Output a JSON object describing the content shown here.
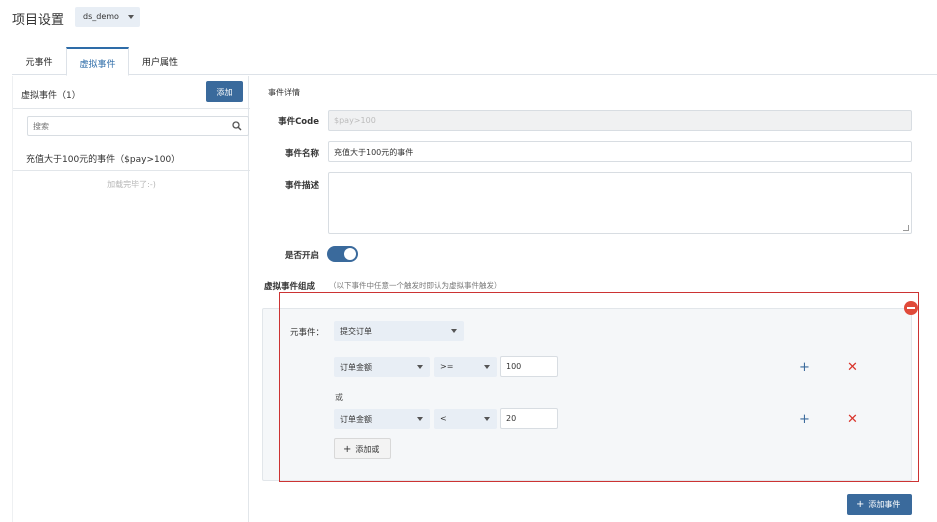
{
  "header": {
    "title": "项目设置",
    "project_select": "ds_demo"
  },
  "tabs": [
    {
      "label": "元事件"
    },
    {
      "label": "虚拟事件"
    },
    {
      "label": "用户属性"
    }
  ],
  "left": {
    "title": "虚拟事件（1）",
    "add_button": "添加",
    "search_placeholder": "搜索",
    "items": [
      {
        "label": "充值大于100元的事件（$pay>100）"
      }
    ],
    "loaded_text": "加载完毕了:-)"
  },
  "right": {
    "section_title": "事件详情",
    "event_code_label": "事件Code",
    "event_code_value": "$pay>100",
    "event_name_label": "事件名称",
    "event_name_value": "充值大于100元的事件",
    "event_desc_label": "事件描述",
    "enabled_label": "是否开启",
    "enabled": true,
    "composition_label": "虚拟事件组成",
    "composition_hint": "（以下事件中任意一个触发时即认为虚拟事件触发）",
    "meta_event_label": "元事件：",
    "meta_event_value": "提交订单",
    "conditions": [
      {
        "field": "订单金额",
        "operator": ">=",
        "value": "100"
      },
      {
        "field": "订单金额",
        "operator": "<",
        "value": "20"
      }
    ],
    "or_label": "或",
    "add_or_button": "添加或",
    "add_event_button": "添加事件"
  },
  "colors": {
    "primary": "#3a6a9c",
    "danger": "#d9342b",
    "highlight_frame": "#cc3333"
  }
}
